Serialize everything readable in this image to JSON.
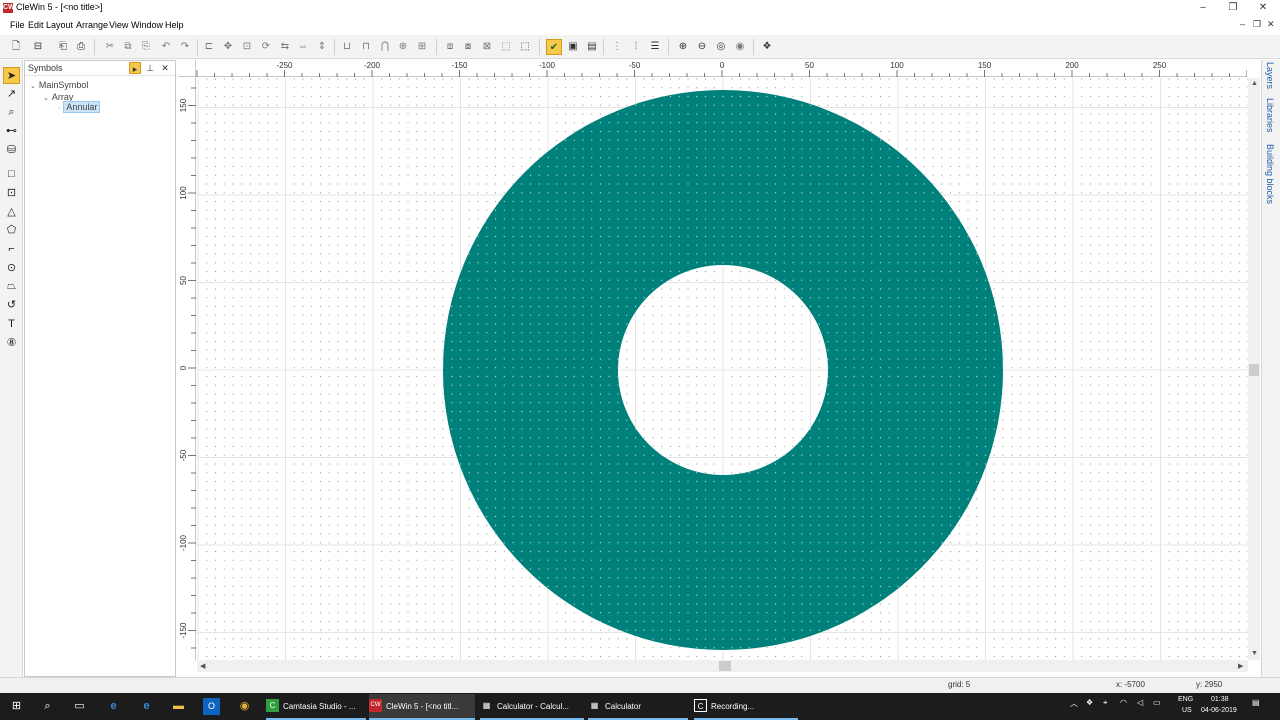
{
  "window": {
    "title": "CleWin 5 - [<no title>]",
    "app_icon": "CW",
    "minimize": "–",
    "maximize": "❐",
    "close": "✕"
  },
  "menu": {
    "items": [
      "File",
      "Edit",
      "Layout",
      "Arrange",
      "View",
      "Window",
      "Help"
    ],
    "mdi_minimize": "–",
    "mdi_restore": "❐",
    "mdi_close": "✕"
  },
  "symbols_panel": {
    "title": "Symbols",
    "tree": [
      {
        "label": "MainSymbol",
        "level": 0,
        "expanded": true
      },
      {
        "label": "Array",
        "level": 1,
        "expanded": true
      },
      {
        "label": "Annular",
        "level": 2,
        "selected": true
      }
    ]
  },
  "ruler": {
    "x_labels": [
      "-250",
      "-200",
      "-150",
      "-100",
      "-50",
      "0",
      "50",
      "100",
      "150",
      "200",
      "250"
    ],
    "y_labels": [
      "150",
      "100",
      "50",
      "0",
      "-50",
      "-100",
      "-150"
    ]
  },
  "canvas": {
    "shape": "annulus",
    "outer_radius": 160,
    "inner_radius": 60,
    "center": [
      0,
      0
    ],
    "fill_color": "#00807a",
    "grid_step": 5
  },
  "right_tabs": [
    "Layers",
    "Libraries",
    "Building blocks"
  ],
  "statusbar": {
    "grid": "grid: 5",
    "x": "x: -5700",
    "y": "y: 2950"
  },
  "taskbar": {
    "tasks": [
      {
        "label": "Camtasia Studio - ...",
        "icon": "C",
        "icon_color": "#2e9e3e",
        "active": false
      },
      {
        "label": "CleWin 5 - [<no titl...",
        "icon": "CW",
        "icon_color": "#c0282d",
        "active": true
      },
      {
        "label": "Calculator - Calcul...",
        "icon": "▦",
        "icon_color": "#ffffff",
        "active": false
      },
      {
        "label": "Calculator",
        "icon": "▦",
        "icon_color": "#ffffff",
        "active": false
      },
      {
        "label": "Recording...",
        "icon": "C",
        "icon_color": "#ffffff",
        "active": false
      }
    ],
    "lang_top": "ENG",
    "lang_bottom": "US",
    "time": "01:38",
    "date": "04-06-2019"
  }
}
